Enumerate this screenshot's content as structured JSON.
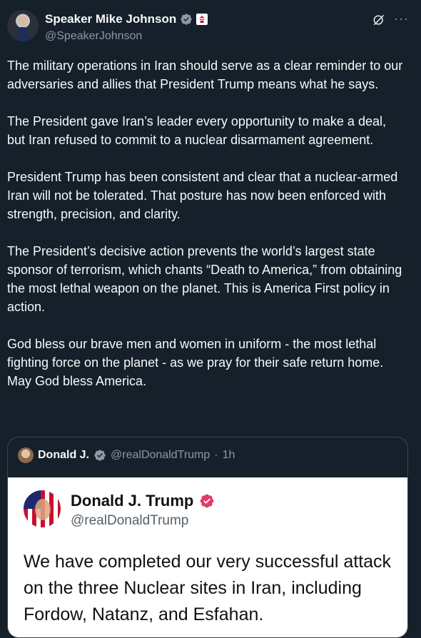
{
  "author": {
    "display_name": "Speaker Mike Johnson",
    "handle": "@SpeakerJohnson"
  },
  "icons": {
    "verified": "verified-badge-icon",
    "government_badge": "government-badge-icon",
    "grok": "grok-icon",
    "more": "more-icon"
  },
  "colors": {
    "background": "#15202b",
    "verified_blue": "#8b98a5",
    "truth_badge": "#e03d6a"
  },
  "tweet": {
    "paragraphs": [
      "The military operations in Iran should serve as a clear reminder to our adversaries and allies that President Trump means what he says.",
      "The President gave Iran’s leader every opportunity to make a deal, but Iran refused to commit to a nuclear disarmament agreement.",
      "President Trump has been consistent and clear that a nuclear-armed Iran will not be tolerated. That posture has now been enforced with strength, precision, and clarity.",
      "The President’s decisive action prevents the world’s largest state sponsor of terrorism, which chants “Death to America,” from obtaining the most lethal weapon on the planet. This is America First policy in action.",
      "God bless our brave men and women in uniform - the most lethal fighting force on the planet - as we pray for their safe return home. May God bless America."
    ]
  },
  "quote": {
    "display_name": "Donald J.",
    "handle": "@realDonaldTrump",
    "separator": "·",
    "time": "1h",
    "card": {
      "name": "Donald J. Trump",
      "handle": "@realDonaldTrump",
      "text": "We have completed our very successful attack on the three Nuclear sites in Iran, including Fordow, Natanz, and Esfahan."
    }
  }
}
